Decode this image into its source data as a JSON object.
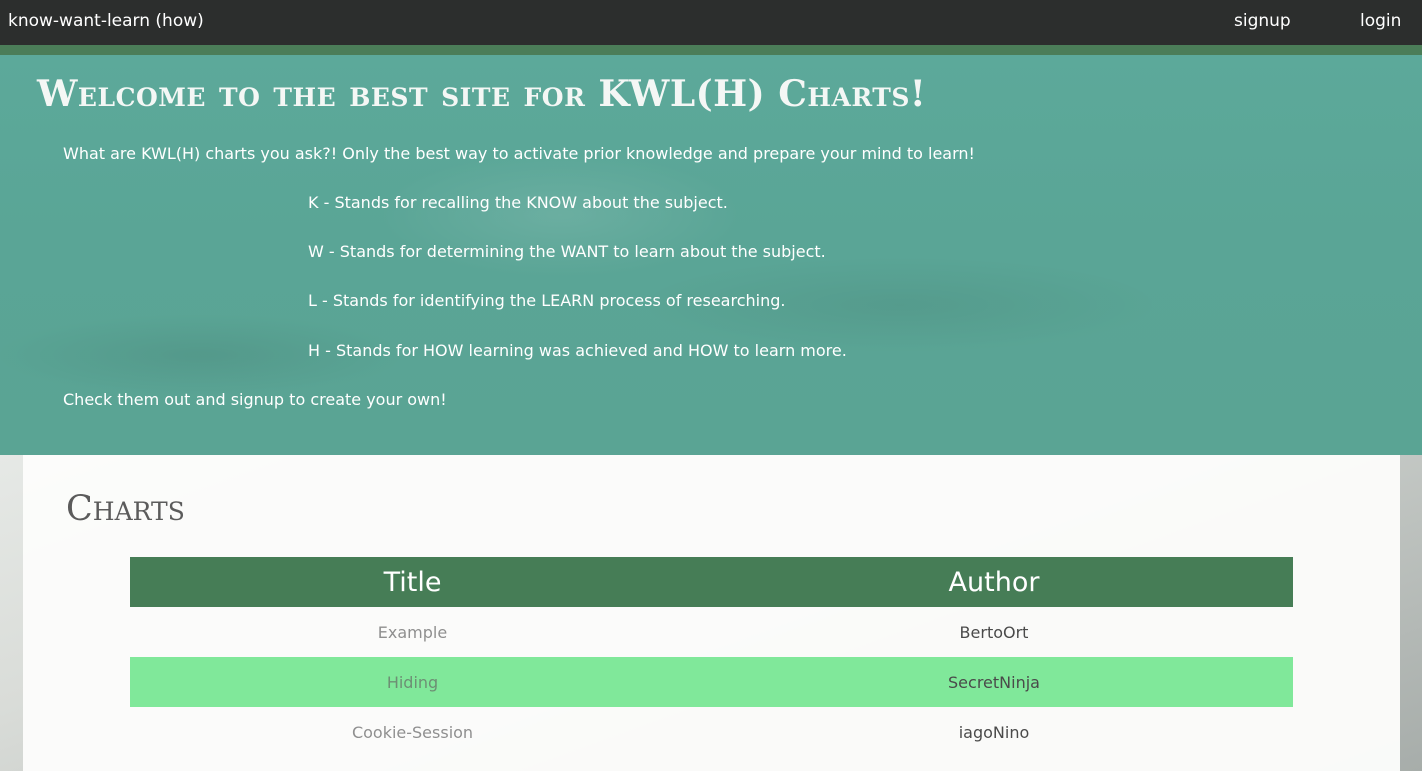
{
  "nav": {
    "brand": "know-want-learn (how)",
    "signup": "signup",
    "login": "login"
  },
  "hero": {
    "title": "Welcome to the best site for KWL(H) Charts!",
    "intro": "What are KWL(H) charts you ask?! Only the best way to activate prior knowledge and prepare your mind to learn!",
    "items": [
      "K - Stands for recalling the KNOW about the subject.",
      "W - Stands for determining the WANT to learn about the subject.",
      "L - Stands for identifying the LEARN process of researching.",
      "H - Stands for HOW learning was achieved and HOW to learn more."
    ],
    "cta": "Check them out and signup to create your own!"
  },
  "charts": {
    "heading": "Charts",
    "columns": [
      "Title",
      "Author"
    ],
    "rows": [
      {
        "title": "Example",
        "author": "BertoOrt"
      },
      {
        "title": "Hiding",
        "author": "SecretNinja"
      },
      {
        "title": "Cookie-Session",
        "author": "iagoNino"
      }
    ]
  },
  "colors": {
    "nav_bg": "#2c2e2d",
    "accent_green": "#467d56",
    "hero_teal": "#5aa596",
    "highlight_row": "#80e89a"
  }
}
